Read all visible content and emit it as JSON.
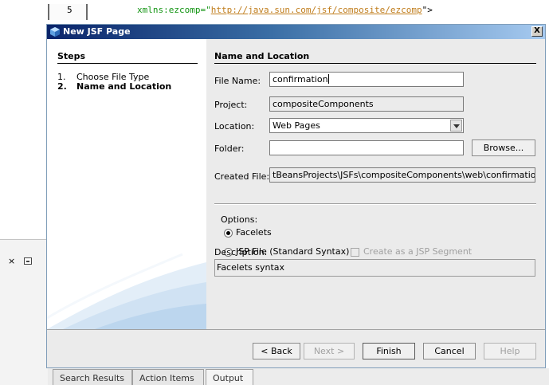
{
  "editor": {
    "line_number": "5",
    "code_prefix": "xmlns:ezcomp=\"",
    "code_url": "http://java.sun.com/jsf/composite/ezcomp",
    "code_suffix": "\">"
  },
  "background": {
    "tabs": [
      "Search Results",
      "Action Items",
      "Output ×"
    ]
  },
  "dialog": {
    "title": "New JSF Page",
    "close_label": "X",
    "steps": {
      "title": "Steps",
      "items": [
        {
          "num": "1.",
          "label": "Choose File Type"
        },
        {
          "num": "2.",
          "label": "Name and Location"
        }
      ]
    },
    "section_title": "Name and Location",
    "file_name": {
      "label": "File Name:",
      "value": "confirmation"
    },
    "project": {
      "label": "Project:",
      "value": "compositeComponents"
    },
    "location": {
      "label": "Location:",
      "value": "Web Pages"
    },
    "folder": {
      "label": "Folder:",
      "value": "",
      "browse_label": "Browse..."
    },
    "created_file": {
      "label": "Created File:",
      "value": "tBeansProjects\\JSFs\\compositeComponents\\web\\confirmation.xhtml"
    },
    "options": {
      "label": "Options:",
      "facelets": "Facelets",
      "jsp_file": "JSP File (Standard Syntax)",
      "jsp_segment": "Create as a JSP Segment"
    },
    "description": {
      "label": "Description:",
      "value": "Facelets syntax"
    },
    "buttons": {
      "back": "< Back",
      "next": "Next >",
      "finish": "Finish",
      "cancel": "Cancel",
      "help": "Help"
    }
  },
  "colors": {
    "title_bar": "#0a246a",
    "dialog_bg": "#ebebeb",
    "code_green": "#129412",
    "code_url": "#c07d1c"
  }
}
